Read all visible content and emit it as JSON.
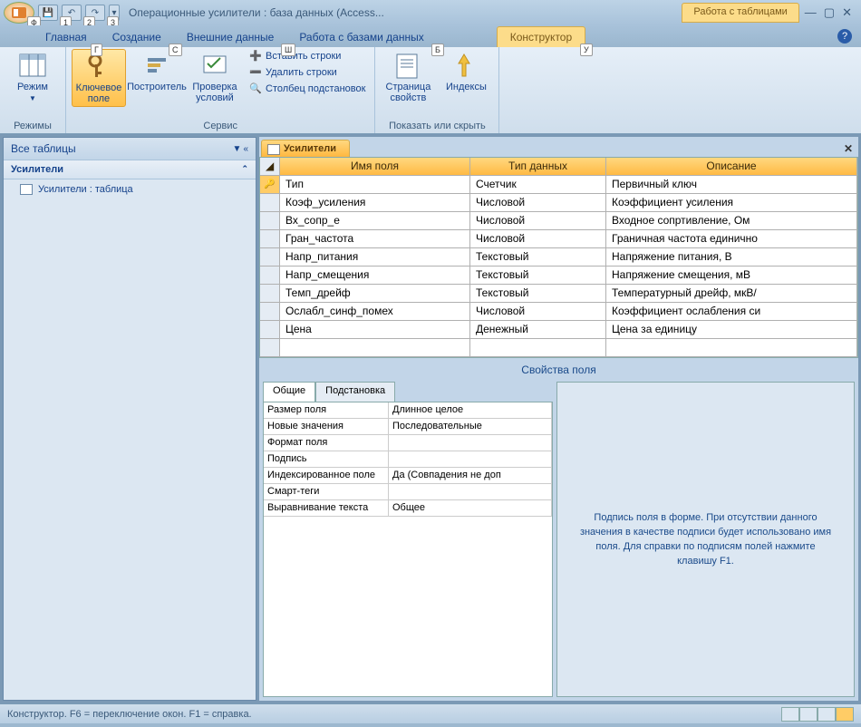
{
  "title": "Операционные усилители : база данных (Access...",
  "context_tab": "Работа с таблицами",
  "tabs": [
    "Главная",
    "Создание",
    "Внешние данные",
    "Работа с базами данных",
    "Конструктор"
  ],
  "key_hints": {
    "office": "Ф",
    "qat1": "1",
    "qat2": "2",
    "qat3": "3",
    "home": "Г",
    "create": "С",
    "extdata": "Ш",
    "dbwork": "Б",
    "design": "У"
  },
  "ribbon": {
    "g1": {
      "mode": "Режим",
      "label": "Режимы"
    },
    "g2": {
      "key": "Ключевое\nполе",
      "builder": "Построитель",
      "validate": "Проверка\nусловий",
      "insert": "Вставить строки",
      "delete": "Удалить строки",
      "lookup": "Столбец  подстановок",
      "label": "Сервис"
    },
    "g3": {
      "propsheet": "Страница\nсвойств",
      "indexes": "Индексы",
      "label": "Показать или скрыть"
    }
  },
  "nav": {
    "title": "Все таблицы",
    "group": "Усилители",
    "item": "Усилители : таблица"
  },
  "doc": {
    "tab": "Усилители",
    "cols": [
      "Имя поля",
      "Тип данных",
      "Описание"
    ],
    "rows": [
      {
        "name": "Тип",
        "type": "Счетчик",
        "desc": "Первичный ключ",
        "pk": true
      },
      {
        "name": "Коэф_усиления",
        "type": "Числовой",
        "desc": "Коэффициент усиления"
      },
      {
        "name": "Вх_сопр_е",
        "type": "Числовой",
        "desc": "Входное сопртивление, Ом"
      },
      {
        "name": "Гран_частота",
        "type": "Числовой",
        "desc": "Граничная частота единично"
      },
      {
        "name": "Напр_питания",
        "type": "Текстовый",
        "desc": "Напряжение питания,  В"
      },
      {
        "name": "Напр_смещения",
        "type": "Текстовый",
        "desc": "Напряжение смещения, мВ"
      },
      {
        "name": "Темп_дрейф",
        "type": "Текстовый",
        "desc": "Температурный дрейф, мкВ/"
      },
      {
        "name": "Ослабл_синф_помех",
        "type": "Числовой",
        "desc": "Коэффициент ослабления си"
      },
      {
        "name": "Цена",
        "type": "Денежный",
        "desc": "Цена за единицу"
      }
    ],
    "props_title": "Свойства поля",
    "prop_tabs": [
      "Общие",
      "Подстановка"
    ],
    "props": [
      {
        "n": "Размер поля",
        "v": "Длинное целое"
      },
      {
        "n": "Новые значения",
        "v": "Последовательные"
      },
      {
        "n": "Формат поля",
        "v": ""
      },
      {
        "n": "Подпись",
        "v": ""
      },
      {
        "n": "Индексированное поле",
        "v": "Да (Совпадения не доп"
      },
      {
        "n": "Смарт-теги",
        "v": ""
      },
      {
        "n": "Выравнивание текста",
        "v": "Общее"
      }
    ],
    "hint": "Подпись поля в форме.  При отсутствии данного значения в качестве подписи будет использовано имя поля.  Для справки по подписям полей нажмите клавишу F1."
  },
  "status": "Конструктор.  F6 = переключение окон.  F1 = справка."
}
